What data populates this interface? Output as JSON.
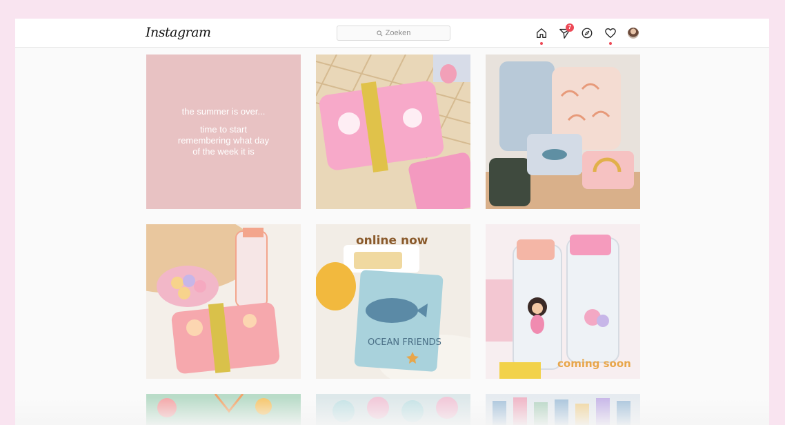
{
  "header": {
    "logo_text": "Instagram",
    "search_placeholder": "Zoeken",
    "activity_badge": "7"
  },
  "posts": [
    {
      "caption_line1": "the summer is over...",
      "caption_line2": "time to start",
      "caption_line3": "remembering what day",
      "caption_line4": "of the week it is"
    },
    {
      "overlay": ""
    },
    {
      "overlay": ""
    },
    {
      "overlay": ""
    },
    {
      "overlay": "online now",
      "book_text_line1": "OCEAN FRIENDS"
    },
    {
      "overlay": "coming soon"
    }
  ],
  "colors": {
    "page_bg": "#f9e4f0",
    "accent_red": "#ed4956",
    "overlay_brown": "#8a5a2b",
    "overlay_orange": "#e8a64a"
  },
  "icons": [
    "home-icon",
    "direct-icon",
    "explore-icon",
    "heart-icon",
    "profile-avatar"
  ]
}
